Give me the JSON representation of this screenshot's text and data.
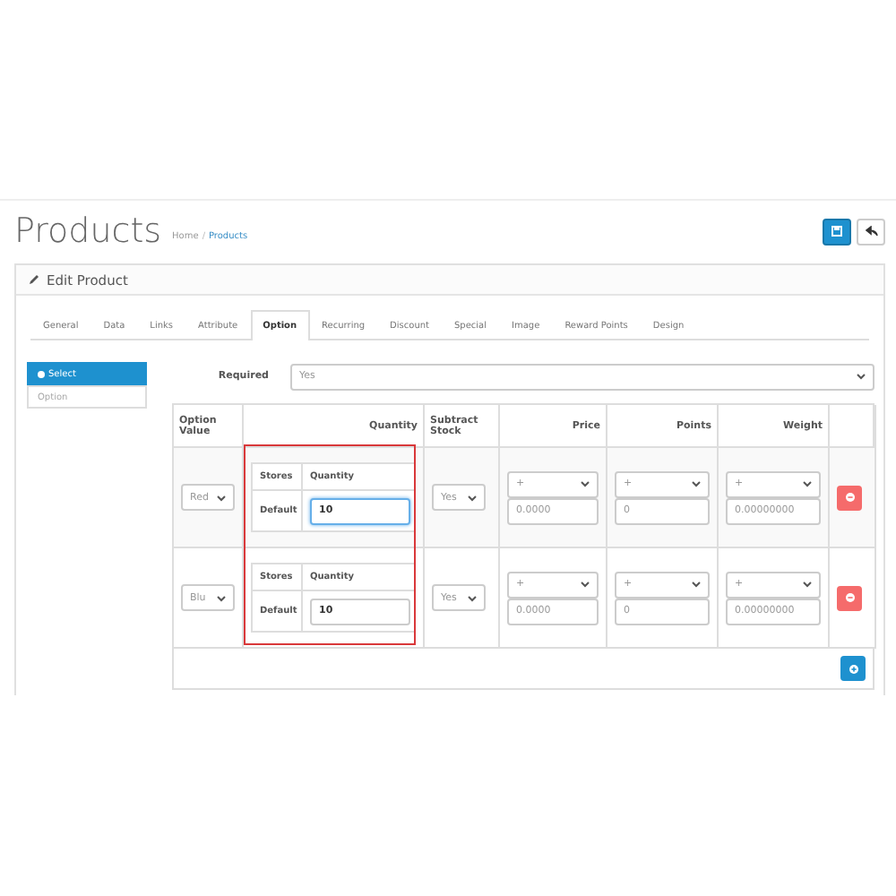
{
  "page_title": "Products",
  "breadcrumb": [
    "Home",
    "Products"
  ],
  "breadcrumb_separator": "/",
  "panel_title": "Edit Product",
  "tabs": [
    {
      "label": "General",
      "selected": false
    },
    {
      "label": "Data",
      "selected": false
    },
    {
      "label": "Links",
      "selected": false
    },
    {
      "label": "Attribute",
      "selected": false
    },
    {
      "label": "Option",
      "selected": true
    },
    {
      "label": "Recurring",
      "selected": false
    },
    {
      "label": "Discount",
      "selected": false
    },
    {
      "label": "Special",
      "selected": false
    },
    {
      "label": "Image",
      "selected": false
    },
    {
      "label": "Reward Points",
      "selected": false
    },
    {
      "label": "Design",
      "selected": false
    }
  ],
  "option_list": [
    {
      "label": "Select",
      "selected": true
    },
    {
      "label": "Option",
      "selected": false
    }
  ],
  "required": {
    "label": "Required",
    "value": "Yes"
  },
  "table": {
    "columns": [
      "Option Value",
      "Quantity",
      "Subtract Stock",
      "Price",
      "Points",
      "Weight"
    ],
    "rows": [
      {
        "option_value": "Red",
        "stores_header": "Stores",
        "quantity_header": "Quantity",
        "store": "Default",
        "quantity": "10",
        "focused": true,
        "subtract": "Yes",
        "price_prefix": "+",
        "price": "0.0000",
        "points_prefix": "+",
        "points": "0",
        "weight_prefix": "+",
        "weight": "0.00000000"
      },
      {
        "option_value": "Blu",
        "stores_header": "Stores",
        "quantity_header": "Quantity",
        "store": "Default",
        "quantity": "10",
        "focused": false,
        "subtract": "Yes",
        "price_prefix": "+",
        "price": "0.0000",
        "points_prefix": "+",
        "points": "0",
        "weight_prefix": "+",
        "weight": "0.00000000"
      }
    ]
  }
}
